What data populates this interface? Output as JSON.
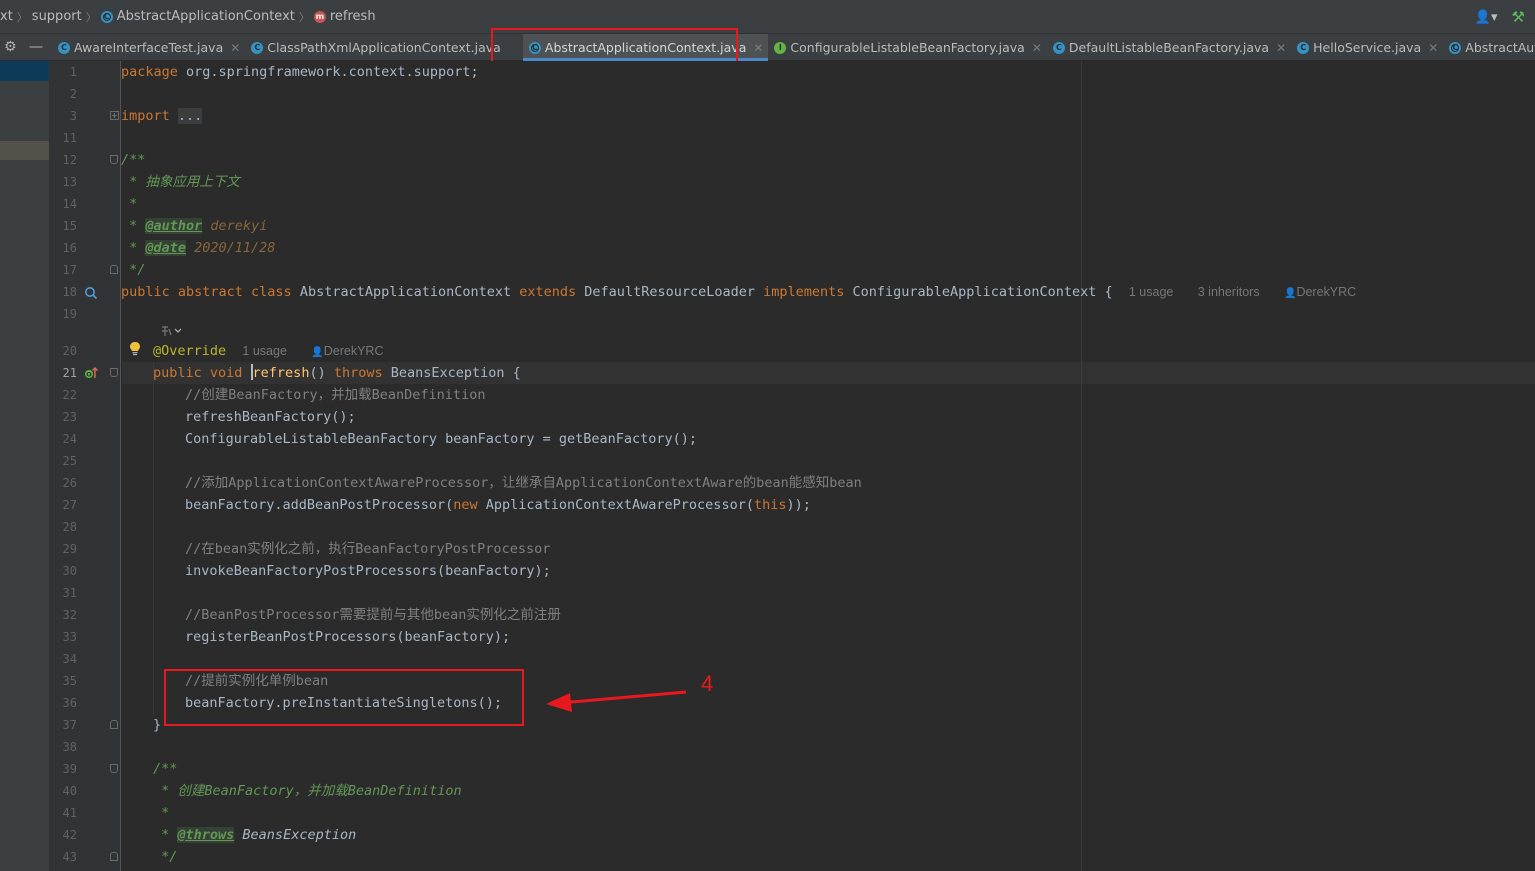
{
  "breadcrumb": [
    {
      "label": "xt",
      "icon": ""
    },
    {
      "label": "support",
      "icon": ""
    },
    {
      "label": "AbstractApplicationContext",
      "icon": "abstract-class-icon"
    },
    {
      "label": "refresh",
      "icon": "method-icon"
    }
  ],
  "tabs": [
    {
      "label": "AwareInterfaceTest.java",
      "icon": "class-icon",
      "active": false
    },
    {
      "label": "ClassPathXmlApplicationContext.java",
      "icon": "class-icon",
      "active": false
    },
    {
      "label": "AbstractApplicationContext.java",
      "icon": "abstract-class-icon",
      "active": true
    },
    {
      "label": "ConfigurableListableBeanFactory.java",
      "icon": "interface-icon",
      "active": false
    },
    {
      "label": "DefaultListableBeanFactory.java",
      "icon": "class-icon",
      "active": false
    },
    {
      "label": "HelloService.java",
      "icon": "class-icon",
      "active": false
    },
    {
      "label": "AbstractAutowireCap",
      "icon": "abstract-class-icon",
      "active": false
    }
  ],
  "editor": {
    "line_numbers": [
      "1",
      "2",
      "3",
      "11",
      "12",
      "13",
      "14",
      "15",
      "16",
      "17",
      "18",
      "19",
      "",
      "20",
      "21",
      "22",
      "23",
      "24",
      "25",
      "26",
      "27",
      "28",
      "29",
      "30",
      "31",
      "32",
      "33",
      "34",
      "35",
      "36",
      "37",
      "38",
      "39",
      "40",
      "41",
      "42",
      "43"
    ],
    "current_line": "21",
    "code": {
      "l1_kw": "package",
      "l1_rest": " org.springframework.context.support;",
      "l3_kw": "import",
      "l3_fold": "...",
      "l12": "/**",
      "l13": " * 抽象应用上下文",
      "l14": " *",
      "l15_star": " * ",
      "l15_tag": "@author",
      "l15_val": " derekyi",
      "l16_star": " * ",
      "l16_tag": "@date",
      "l16_val": " 2020/11/28",
      "l17": " */",
      "l18_kw1": "public abstract class",
      "l18_name": " AbstractApplicationContext ",
      "l18_kw2": "extends",
      "l18_sup": " DefaultResourceLoader ",
      "l18_kw3": "implements",
      "l18_iface": " ConfigurableApplicationContext {",
      "l18_hint_usage": "1 usage",
      "l18_hint_inh": "3 inheritors",
      "l18_hint_author": "DerekYRC",
      "l20_ann": "@Override",
      "l20_hint_usage": "1 usage",
      "l20_hint_author": "DerekYRC",
      "l21_kw": "public void ",
      "l21_meth": "refresh",
      "l21_paren": "() ",
      "l21_kw2": "throws",
      "l21_rest": " BeansException {",
      "l22": "//创建BeanFactory，并加载BeanDefinition",
      "l23": "refreshBeanFactory();",
      "l24": "ConfigurableListableBeanFactory beanFactory = getBeanFactory();",
      "l26": "//添加ApplicationContextAwareProcessor，让继承自ApplicationContextAware的bean能感知bean",
      "l27_a": "beanFactory.addBeanPostProcessor(",
      "l27_kw": "new",
      "l27_b": " ApplicationContextAwareProcessor(",
      "l27_kw2": "this",
      "l27_c": "));",
      "l29": "//在bean实例化之前，执行BeanFactoryPostProcessor",
      "l30": "invokeBeanFactoryPostProcessors(beanFactory);",
      "l32": "//BeanPostProcessor需要提前与其他bean实例化之前注册",
      "l33": "registerBeanPostProcessors(beanFactory);",
      "l35": "//提前实例化单例bean",
      "l36": "beanFactory.preInstantiateSingletons();",
      "l37": "}",
      "l39": "/**",
      "l40": " * 创建BeanFactory，并加载BeanDefinition",
      "l41": " *",
      "l42_star": " * ",
      "l42_tag": "@throws",
      "l42_val": " BeansException",
      "l43": " */"
    }
  },
  "annotation": {
    "number": "4",
    "color": "#e8191e"
  },
  "colors": {
    "keyword": "#cc7832",
    "comment": "#808080",
    "doc": "#629755",
    "method": "#ffc66d",
    "annotation": "#bbb529",
    "accent": "#4a88c7"
  }
}
